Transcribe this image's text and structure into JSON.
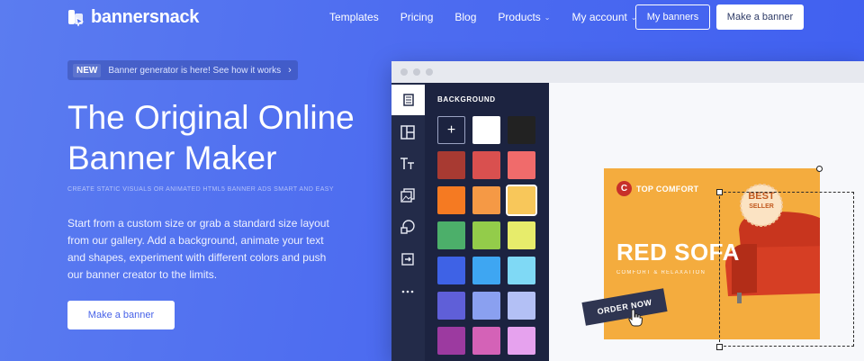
{
  "header": {
    "logo_text": "bannersnack",
    "nav": [
      {
        "label": "Templates",
        "has_dropdown": false
      },
      {
        "label": "Pricing",
        "has_dropdown": false
      },
      {
        "label": "Blog",
        "has_dropdown": false
      },
      {
        "label": "Products",
        "has_dropdown": true
      },
      {
        "label": "My account",
        "has_dropdown": true
      }
    ],
    "my_banners_label": "My banners",
    "make_banner_label": "Make a banner"
  },
  "hero": {
    "badge": "NEW",
    "announcement": "Banner generator is here! See how it works",
    "title_line1": "The Original Online",
    "title_line2": "Banner Maker",
    "subtitle": "CREATE STATIC VISUALS OR ANIMATED HTML5 BANNER ADS SMART AND EASY",
    "description": "Start from a custom size or grab a standard size layout from our gallery. Add a background, animate your text and shapes, experiment with different colors and push our banner creator to the limits.",
    "cta_label": "Make a banner"
  },
  "editor": {
    "panel_title": "BACKGROUND",
    "tools": [
      "layers-icon",
      "layout-icon",
      "text-icon",
      "image-icon",
      "shapes-icon",
      "button-icon",
      "more-icon"
    ],
    "swatches": [
      [
        "add",
        "#ffffff",
        "#222222"
      ],
      [
        "#a83a32",
        "#d9504f",
        "#f06b6b"
      ],
      [
        "#f57a22",
        "#f59945",
        "#f8c75a"
      ],
      [
        "#4caf6a",
        "#93cc4a",
        "#e7ec6b"
      ],
      [
        "#3e62e6",
        "#3ea6f2",
        "#7fd9f5"
      ],
      [
        "#5f5fd8",
        "#8aa0f0",
        "#b3c0f5"
      ],
      [
        "#9c3aa0",
        "#d462b7",
        "#e6a2ee"
      ]
    ],
    "selected_swatch": "#f8c75a",
    "banner": {
      "brand_initial": "C",
      "brand_name": "TOP COMFORT",
      "badge_line1": "BEST",
      "badge_line2": "SELLER",
      "headline": "RED SOFA",
      "subline": "COMFORT & RELAXATION",
      "cta": "ORDER NOW",
      "background": "#f4ac3e"
    }
  },
  "colors": {
    "bg_gradient_start": "#5b7cf0",
    "bg_gradient_end": "#3f5ff0",
    "panel_dark": "#1c2340",
    "rail_dark": "#232b49"
  }
}
